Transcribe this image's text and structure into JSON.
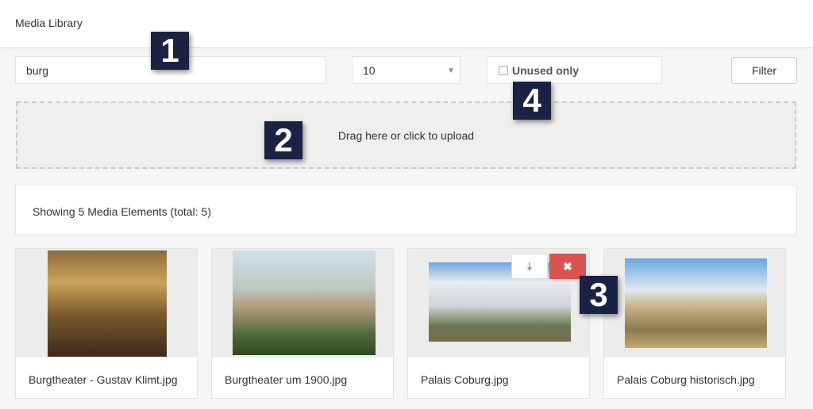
{
  "header": {
    "title": "Media Library"
  },
  "filters": {
    "search_value": "burg",
    "per_page": "10",
    "unused_label": "Unused only",
    "unused_checked": false,
    "filter_label": "Filter"
  },
  "upload": {
    "label": "Drag here or click to upload"
  },
  "info": {
    "text": "Showing 5 Media Elements (total: 5)"
  },
  "media": [
    {
      "name": "Burgtheater - Gustav Klimt.jpg"
    },
    {
      "name": "Burgtheater um 1900.jpg"
    },
    {
      "name": "Palais Coburg.jpg",
      "actions": [
        "download-icon",
        "delete-icon"
      ]
    },
    {
      "name": "Palais Coburg historisch.jpg"
    }
  ],
  "actions": {
    "delete_glyph": "✖"
  },
  "callouts": [
    "1",
    "2",
    "3",
    "4"
  ],
  "colors": {
    "delete": "#d9534f",
    "callout": "#1b2344"
  }
}
